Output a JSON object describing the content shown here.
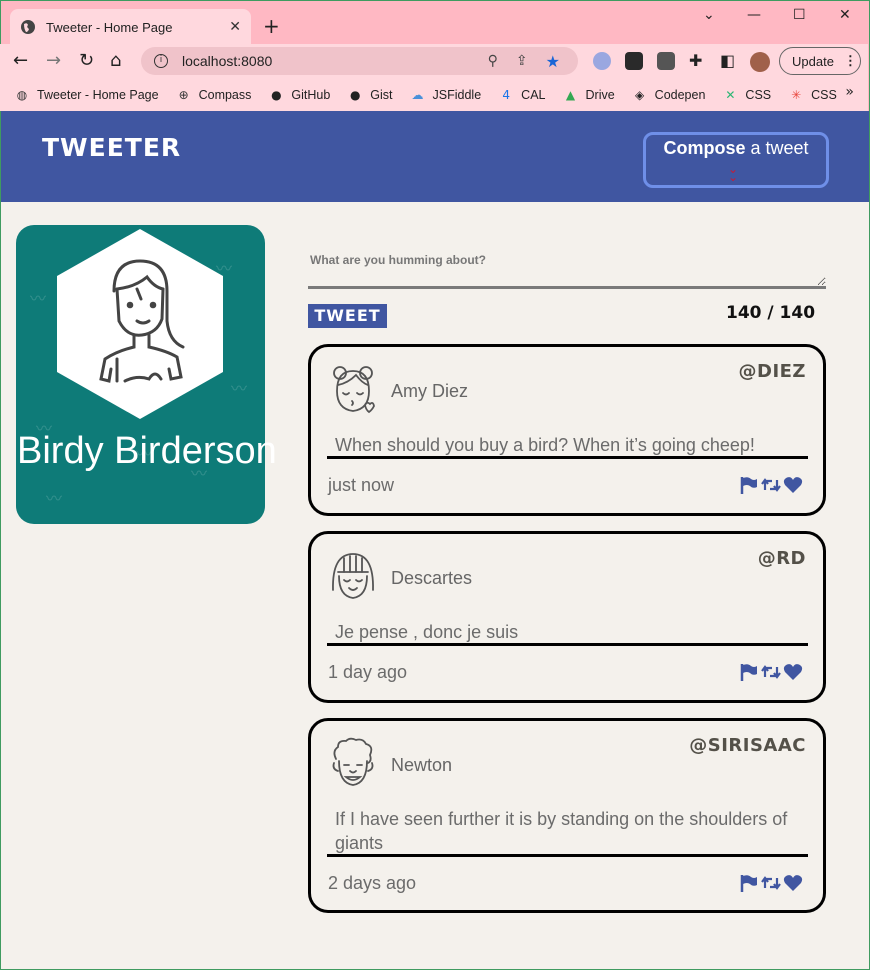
{
  "browser": {
    "tab_title": "Tweeter - Home Page",
    "tab_close": "✕",
    "new_tab": "+",
    "url": "localhost:8080",
    "update_label": "Update",
    "bookmarks": [
      {
        "label": "Tweeter - Home Page",
        "icon": "globe-icon",
        "color": "#333333"
      },
      {
        "label": "Compass",
        "icon": "compass-icon",
        "color": "#333333"
      },
      {
        "label": "GitHub",
        "icon": "github-icon",
        "color": "#222222"
      },
      {
        "label": "Gist",
        "icon": "github-icon",
        "color": "#222222"
      },
      {
        "label": "JSFiddle",
        "icon": "jsfiddle-icon",
        "color": "#4a90d9"
      },
      {
        "label": "CAL",
        "icon": "calendar-icon",
        "color": "#1a73e8"
      },
      {
        "label": "Drive",
        "icon": "drive-icon",
        "color": "#34a853"
      },
      {
        "label": "Codepen",
        "icon": "codepen-icon",
        "color": "#222222"
      },
      {
        "label": "CSS",
        "icon": "css-x-icon",
        "color": "#2bb673"
      },
      {
        "label": "CSS",
        "icon": "css-star-icon",
        "color": "#e8453c"
      }
    ]
  },
  "nav": {
    "brand": "TWEETER",
    "compose_bold": "Compose",
    "compose_rest": " a tweet",
    "accent": "#4056a1",
    "chevron_color": "#c21d3a"
  },
  "profile": {
    "name": "Birdy Birderson",
    "bg_color": "#0e7b78"
  },
  "composer": {
    "prompt": "What are you humming about?",
    "button_label": "TWEET",
    "counter": "140 / 140"
  },
  "tweets": [
    {
      "name": "Amy Diez",
      "handle": "@DIEZ",
      "content": "When should you buy a bird? When it’s going cheep!",
      "time": "just now",
      "avatar": "girl-pigtails-avatar-icon"
    },
    {
      "name": "Descartes",
      "handle": "@RD",
      "content": "Je pense , donc je suis",
      "time": "1 day ago",
      "avatar": "girl-bangs-avatar-icon"
    },
    {
      "name": "Newton",
      "handle": "@SIRISAAC",
      "content": "If I have seen further it is by standing on the shoulders of giants",
      "time": "2 days ago",
      "avatar": "curly-man-avatar-icon"
    }
  ],
  "icons": {
    "flag": "flag-icon",
    "retweet": "retweet-icon",
    "heart": "heart-icon",
    "icon_color": "#4056a1"
  }
}
